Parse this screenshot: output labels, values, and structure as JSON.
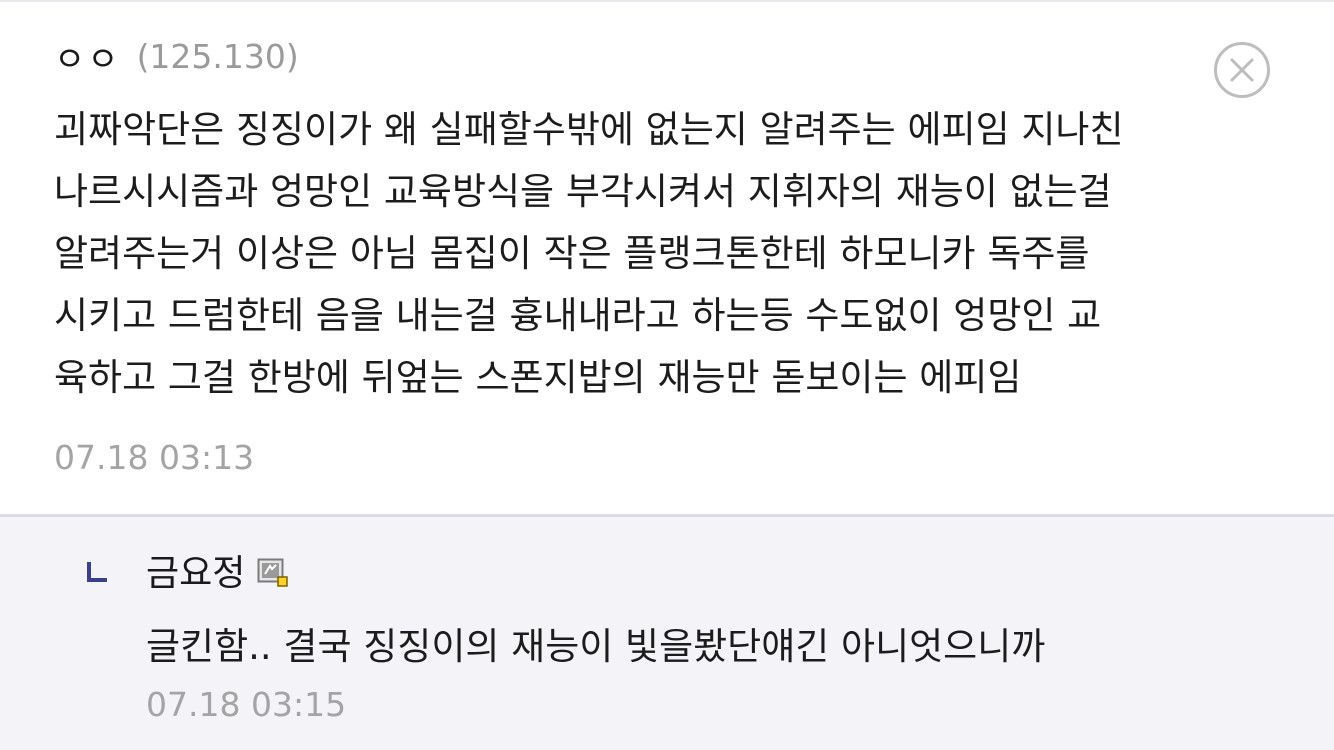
{
  "comment": {
    "author": "ㅇㅇ",
    "ip": "(125.130)",
    "body_lines": [
      "괴짜악단은 징징이가 왜 실패할수밖에 없는지 알려주는 에피임 지나친",
      "나르시시즘과 엉망인 교육방식을 부각시켜서 지휘자의 재능이 없는걸",
      "알려주는거 이상은 아님 몸집이 작은 플랭크톤한테 하모니카 독주를",
      "시키고 드럼한테 음을 내는걸 흉내내라고 하는등 수도없이 엉망인 교",
      "육하고 그걸 한방에 뒤엎는 스폰지밥의 재능만 돋보이는 에피임"
    ],
    "timestamp": "07.18 03:13",
    "delete_icon": "close-circle-icon"
  },
  "reply": {
    "indicator_icon": "reply-arrow-icon",
    "author": "금요정",
    "badge_icon": "user-badge-icon",
    "body": "글킨함.. 결국 징징이의 재능이 빛을봤단얘긴 아니엇으니까",
    "timestamp": "07.18 03:15"
  },
  "colors": {
    "text": "#1c1c1c",
    "meta": "#a4a4a4",
    "reply_background": "#f4f4f8",
    "reply_border": "#dadbe6",
    "reply_indicator": "#3b3f8f",
    "close_icon": "#bdbdbd"
  }
}
